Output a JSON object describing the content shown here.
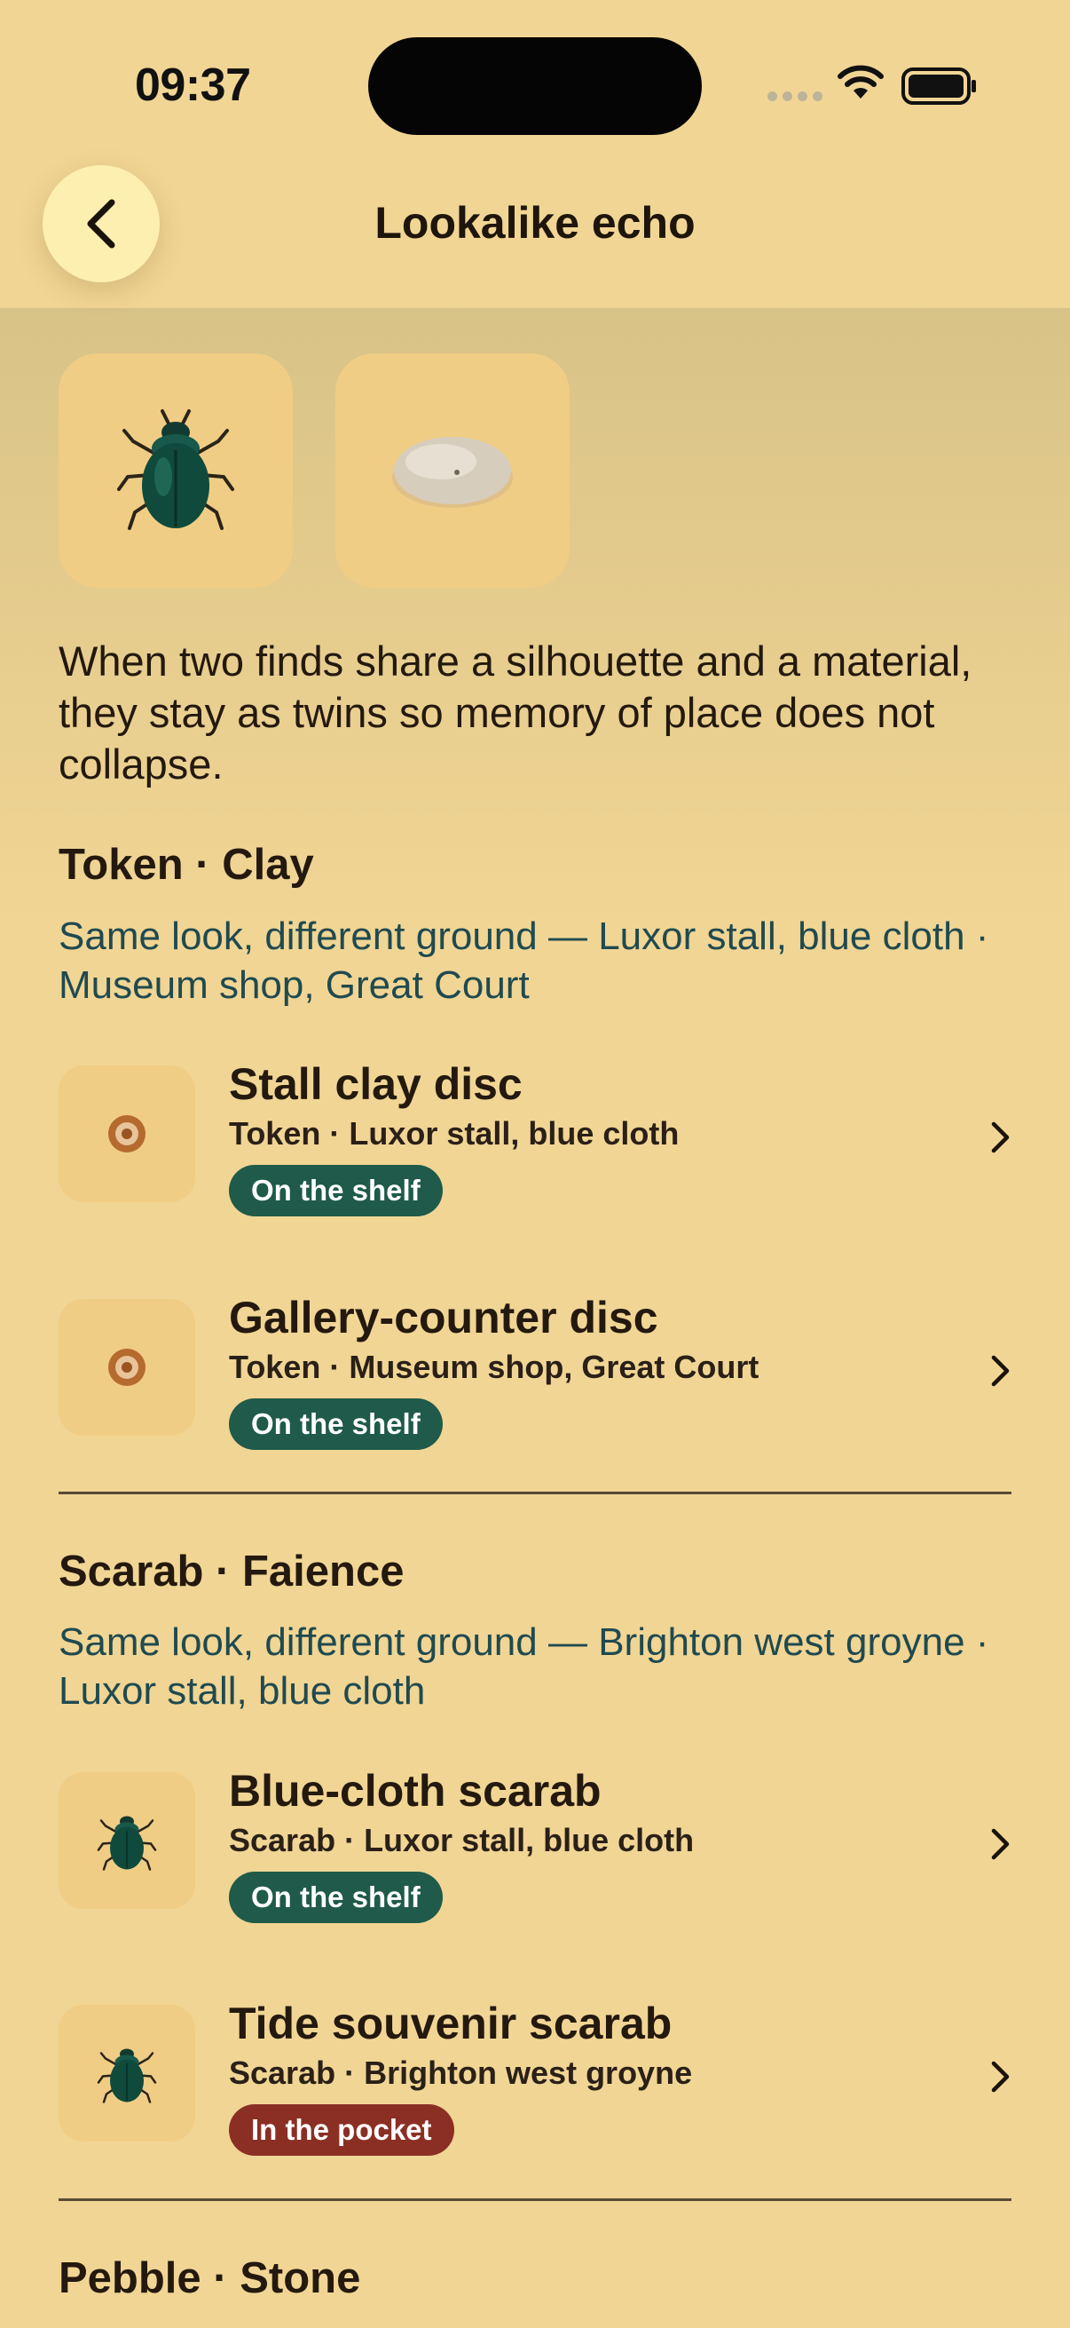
{
  "status_bar": {
    "time": "09:37"
  },
  "header": {
    "title": "Lookalike echo",
    "back_icon": "chevron-left-icon"
  },
  "hero": {
    "tiles": [
      "scarab-beetle-image",
      "pebble-image"
    ]
  },
  "intro": "When two finds share a silhouette and a material, they stay as twins so memory of place does not collapse.",
  "groups": [
    {
      "title": "Token · Clay",
      "subtitle": "Same look, different ground — Luxor stall, blue cloth · Museum shop, Great Court",
      "items": [
        {
          "title": "Stall clay disc",
          "meta": "Token · Luxor stall, blue cloth",
          "badge": "On the shelf"
        },
        {
          "title": "Gallery-counter disc",
          "meta": "Token · Museum shop, Great Court",
          "badge": "On the shelf"
        }
      ]
    },
    {
      "title": "Scarab · Faience",
      "subtitle": "Same look, different ground — Brighton west groyne · Luxor stall, blue cloth",
      "items": [
        {
          "title": "Blue-cloth scarab",
          "meta": "Scarab · Luxor stall, blue cloth",
          "badge": "On the shelf"
        },
        {
          "title": "Tide souvenir scarab",
          "meta": "Scarab · Brighton west groyne",
          "badge": "In the pocket"
        }
      ]
    },
    {
      "title": "Pebble · Stone"
    }
  ],
  "colors": {
    "background": "#f1d594",
    "tile": "#f0cd84",
    "accent_text": "#1f4a50",
    "badge_shelf": "#1f5a4a",
    "badge_pocket": "#8b2f25"
  }
}
